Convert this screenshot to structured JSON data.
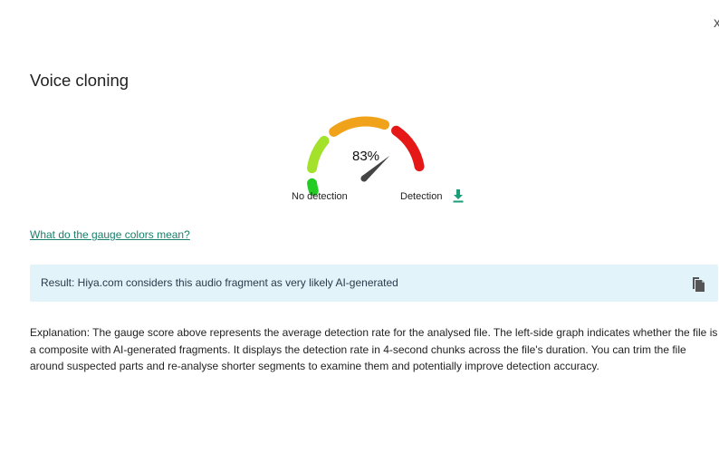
{
  "dialog": {
    "close_glyph": "x",
    "title": "Voice cloning"
  },
  "gauge": {
    "value_text": "83%",
    "score_percent": 83,
    "label_left": "No detection",
    "label_right": "Detection",
    "segment_colors": [
      "#22cc22",
      "#a4e12a",
      "#f0a21a",
      "#e51717"
    ],
    "needle_color": "#444444",
    "download_icon": "download-icon",
    "download_color": "#1a9e78"
  },
  "help_link": {
    "label": "What do the gauge colors mean?"
  },
  "result": {
    "text": "Result: Hiya.com considers this audio fragment as very likely AI-generated",
    "copy_icon": "copy-icon",
    "background": "#e3f3fa"
  },
  "explanation": {
    "text": "Explanation: The gauge score above represents the average detection rate for the analysed file. The left-side graph indicates whether the file is a composite with AI-generated fragments. It displays the detection rate in 4-second chunks across the file's duration. You can trim the file around suspected parts and re-analyse shorter segments to examine them and potentially improve detection accuracy."
  }
}
